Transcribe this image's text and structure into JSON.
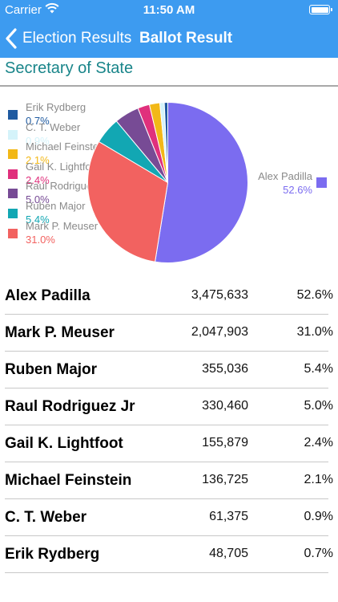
{
  "status_bar": {
    "carrier": "Carrier",
    "time": "11:50 AM"
  },
  "nav": {
    "back_label": "Election Results",
    "title": "Ballot Result"
  },
  "section": {
    "title": "Secretary of State"
  },
  "legend": [
    {
      "name": "Erik Rydberg",
      "pct": "0.7%",
      "color": "#1f5aa0"
    },
    {
      "name": "C. T. Weber",
      "pct": "0.9%",
      "color": "#d4f3fa"
    },
    {
      "name": "Michael Feinstein",
      "pct": "2.1%",
      "color": "#f2b817"
    },
    {
      "name": "Gail K. Lightfoot",
      "pct": "2.4%",
      "color": "#e0307c"
    },
    {
      "name": "Raul Rodriguez Jr",
      "pct": "5.0%",
      "color": "#774b95"
    },
    {
      "name": "Ruben Major",
      "pct": "5.4%",
      "color": "#12a7b3"
    },
    {
      "name": "Mark P. Meuser",
      "pct": "31.0%",
      "color": "#f26260"
    }
  ],
  "legend_right": {
    "name": "Alex Padilla",
    "pct": "52.6%",
    "color": "#7b6cf0"
  },
  "chart_data": {
    "type": "pie",
    "title": "Secretary of State",
    "categories": [
      "Alex Padilla",
      "Mark P. Meuser",
      "Ruben Major",
      "Raul Rodriguez Jr",
      "Gail K. Lightfoot",
      "Michael Feinstein",
      "C. T. Weber",
      "Erik Rydberg"
    ],
    "values": [
      52.6,
      31.0,
      5.4,
      5.0,
      2.4,
      2.1,
      0.9,
      0.7
    ],
    "colors": [
      "#7b6cf0",
      "#f26260",
      "#12a7b3",
      "#774b95",
      "#e0307c",
      "#f2b817",
      "#d4f3fa",
      "#1f5aa0"
    ],
    "direction": "clockwise",
    "start": "top"
  },
  "results": [
    {
      "name": "Alex Padilla",
      "votes": "3,475,633",
      "pct": "52.6%"
    },
    {
      "name": "Mark P. Meuser",
      "votes": "2,047,903",
      "pct": "31.0%"
    },
    {
      "name": "Ruben Major",
      "votes": "355,036",
      "pct": "5.4%"
    },
    {
      "name": "Raul Rodriguez Jr",
      "votes": "330,460",
      "pct": "5.0%"
    },
    {
      "name": "Gail K. Lightfoot",
      "votes": "155,879",
      "pct": "2.4%"
    },
    {
      "name": "Michael Feinstein",
      "votes": "136,725",
      "pct": "2.1%"
    },
    {
      "name": "C. T. Weber",
      "votes": "61,375",
      "pct": "0.9%"
    },
    {
      "name": "Erik Rydberg",
      "votes": "48,705",
      "pct": "0.7%"
    }
  ]
}
